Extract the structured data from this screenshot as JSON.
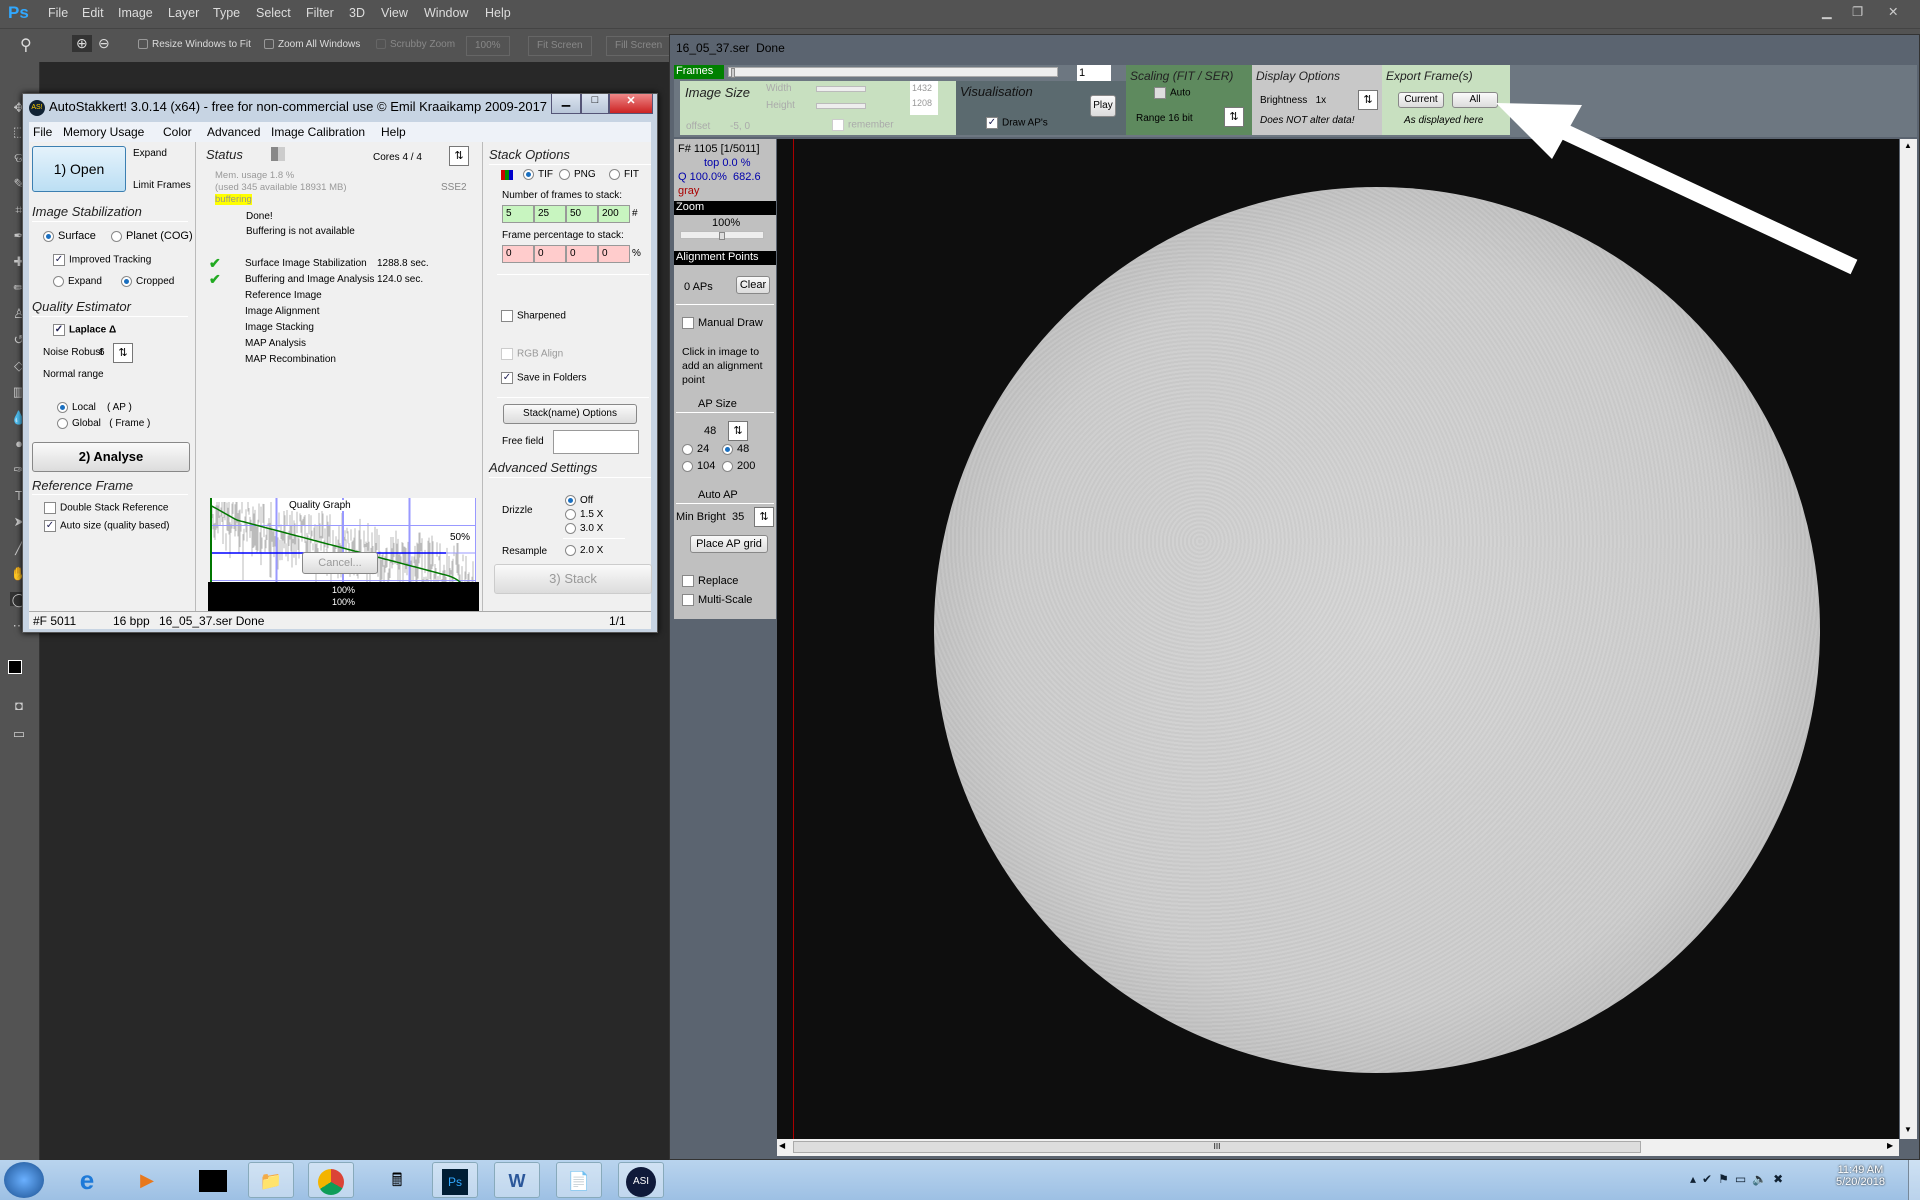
{
  "photoshop": {
    "menu": [
      "File",
      "Edit",
      "Image",
      "Layer",
      "Type",
      "Select",
      "Filter",
      "3D",
      "View",
      "Window",
      "Help"
    ],
    "logo": "Ps",
    "options": {
      "resize_windows": "Resize Windows to Fit",
      "zoom_all": "Zoom All Windows",
      "scrubby": "Scrubby Zoom",
      "zoom_pct": "100%",
      "fit_screen": "Fit Screen",
      "fill_screen": "Fill Screen"
    }
  },
  "autostakkert": {
    "title": "AutoStakkert! 3.0.14 (x64) - free for non-commercial use © Emil Kraaikamp 2009-2017",
    "menu": [
      "File",
      "Memory Usage",
      "Color",
      "Advanced",
      "Image Calibration",
      "Help"
    ],
    "open": "1) Open",
    "expand": "Expand",
    "limit_frames": "Limit Frames",
    "image_stabilization": {
      "heading": "Image Stabilization",
      "surface": "Surface",
      "planet": "Planet (COG)",
      "improved_tracking": "Improved Tracking",
      "expand": "Expand",
      "cropped": "Cropped"
    },
    "quality_estimator": {
      "heading": "Quality Estimator",
      "laplace": "Laplace Δ",
      "noise_robust": "Noise Robust",
      "noise_value": "6",
      "normal_range": "Normal range",
      "local": "Local",
      "local_suffix": "( AP )",
      "global": "Global",
      "global_suffix": "( Frame )"
    },
    "analyse": "2) Analyse",
    "reference_frame": {
      "heading": "Reference Frame",
      "double_stack": "Double Stack Reference",
      "auto_size": "Auto size (quality based)"
    },
    "status": {
      "heading": "Status",
      "cores": "Cores 4 / 4",
      "mem_usage": "Mem. usage 1.8 %",
      "mem_detail": "(used 345 available 18931 MB)",
      "sse": "SSE2",
      "buffering": "buffering",
      "done": "Done!",
      "buffer_na": "Buffering is not available",
      "steps": [
        {
          "label": "Surface Image Stabilization",
          "time": "1288.8 sec.",
          "done": true
        },
        {
          "label": "Buffering and Image Analysis",
          "time": "124.0 sec.",
          "done": true
        },
        {
          "label": "Reference Image",
          "time": "",
          "done": false
        },
        {
          "label": "Image Alignment",
          "time": "",
          "done": false
        },
        {
          "label": "Image Stacking",
          "time": "",
          "done": false
        },
        {
          "label": "MAP Analysis",
          "time": "",
          "done": false
        },
        {
          "label": "MAP Recombination",
          "time": "",
          "done": false
        }
      ]
    },
    "quality_graph": {
      "title": "Quality Graph",
      "marker": "50%"
    },
    "cancel": "Cancel...",
    "progress1": "100%",
    "progress2": "100%",
    "stack_options": {
      "heading": "Stack Options",
      "tif": "TIF",
      "png": "PNG",
      "fit": "FIT",
      "frames_label": "Number of frames to stack:",
      "frames": [
        "5",
        "25",
        "50",
        "200"
      ],
      "frames_unit": "#",
      "pct_label": "Frame percentage to stack:",
      "pcts": [
        "0",
        "0",
        "0",
        "0"
      ],
      "pct_unit": "%",
      "sharpened": "Sharpened",
      "rgb_align": "RGB Align",
      "save_folders": "Save in Folders",
      "stackname": "Stack(name) Options",
      "free_field": "Free field",
      "free_value": ""
    },
    "advanced": {
      "heading": "Advanced Settings",
      "drizzle": "Drizzle",
      "off": "Off",
      "d15": "1.5 X",
      "d30": "3.0 X",
      "resample": "Resample",
      "r20": "2.0 X"
    },
    "stack": "3) Stack",
    "statusbar": {
      "frames": "#F 5011",
      "bpp": "16 bpp",
      "file": "16_05_37.ser  Done",
      "page": "1/1"
    }
  },
  "viewer": {
    "title": "16_05_37.ser  Done",
    "frames_label": "Frames",
    "frame_value": "1",
    "image_size": {
      "heading": "Image Size",
      "width": "Width",
      "height": "Height",
      "width_val": "1432",
      "height_val": "1208",
      "offset": "offset",
      "offset_val": "-5, 0",
      "remember": "remember"
    },
    "visualisation": {
      "heading": "Visualisation",
      "play": "Play",
      "draw_aps": "Draw AP's"
    },
    "scaling": {
      "heading": "Scaling (FIT / SER)",
      "auto": "Auto",
      "range": "Range 16 bit"
    },
    "display": {
      "heading": "Display Options",
      "brightness": "Brightness   1x",
      "note": "Does NOT alter data!"
    },
    "export": {
      "heading": "Export Frame(s)",
      "current": "Current",
      "all": "All",
      "note": "As displayed here"
    },
    "side": {
      "frame": "F# 1105 [1/5011]",
      "top": "top 0.0 %",
      "q": "Q 100.0%  682.6",
      "gray": "gray",
      "zoom": "Zoom",
      "zoom_val": "100%",
      "ap_heading": "Alignment Points",
      "aps": "0 APs",
      "clear": "Clear",
      "manual_draw": "Manual Draw",
      "hint": "Click in image to add an alignment point",
      "ap_size": "AP Size",
      "ap_val": "48",
      "s24": "24",
      "s48": "48",
      "s104": "104",
      "s200": "200",
      "auto_ap": "Auto AP",
      "min_bright": "Min Bright",
      "min_val": "35",
      "place_grid": "Place AP grid",
      "replace": "Replace",
      "multiscale": "Multi-Scale"
    },
    "hscroll_grip": "III"
  },
  "taskbar": {
    "time": "11:49 AM",
    "date": "5/20/2018",
    "apps": [
      "start",
      "internet-explorer",
      "media-player",
      "command-prompt",
      "file-explorer",
      "chrome",
      "calculator",
      "photoshop",
      "word",
      "notepad",
      "asicap"
    ]
  },
  "colors": {
    "green_panel": "#c8e0c0",
    "frames_green": "#008000",
    "scaling_green": "#5e8a5e",
    "ps_bg": "#535353"
  }
}
